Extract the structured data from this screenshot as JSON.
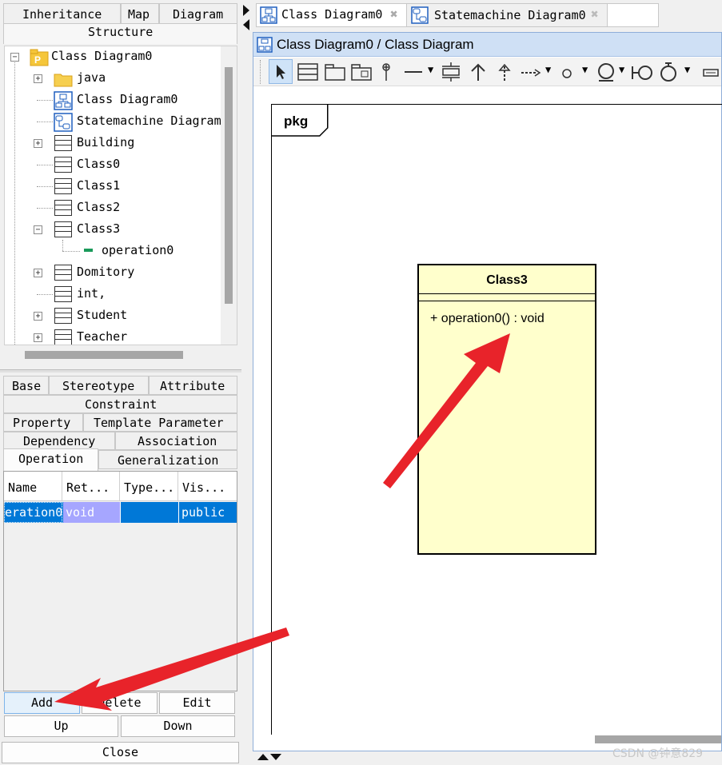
{
  "left_tabs_top": [
    "Inheritance",
    "Map",
    "Diagram"
  ],
  "structure_label": "Structure",
  "tree": {
    "root": "Class Diagram0",
    "items": [
      "java",
      "Class Diagram0",
      "Statemachine Diagram",
      "Building",
      "Class0",
      "Class1",
      "Class2",
      "Class3"
    ],
    "child_op": "operation0",
    "items2": [
      "Domitory",
      "int,",
      "Student",
      "Teacher"
    ]
  },
  "prop_tabs": {
    "row1": [
      "Base",
      "Stereotype",
      "Attribute"
    ],
    "row2": [
      "Constraint"
    ],
    "row3": [
      "Property",
      "Template Parameter"
    ],
    "row4": [
      "Dependency",
      "Association"
    ],
    "row5": [
      "Operation",
      "Generalization"
    ]
  },
  "table": {
    "headers": [
      "Name",
      "Ret...",
      "Type...",
      "Vis..."
    ],
    "row": [
      "eration0",
      "void",
      "",
      "public"
    ]
  },
  "buttons": {
    "add": "Add",
    "delete": "Delete",
    "edit": "Edit",
    "up": "Up",
    "down": "Down",
    "close": "Close"
  },
  "editor_tabs": [
    "Class Diagram0",
    "Statemachine Diagram0"
  ],
  "diagram_title": "Class Diagram0 / Class Diagram",
  "frame_label": "pkg",
  "class_box": {
    "name": "Class3",
    "operation": "+ operation0() : void",
    "fill": "#ffffcc"
  },
  "watermark": "CSDN @钟意829",
  "colors": {
    "selection": "#0078d7",
    "ret_cell": "#a6a6ff",
    "arrow": "#e8232a"
  }
}
